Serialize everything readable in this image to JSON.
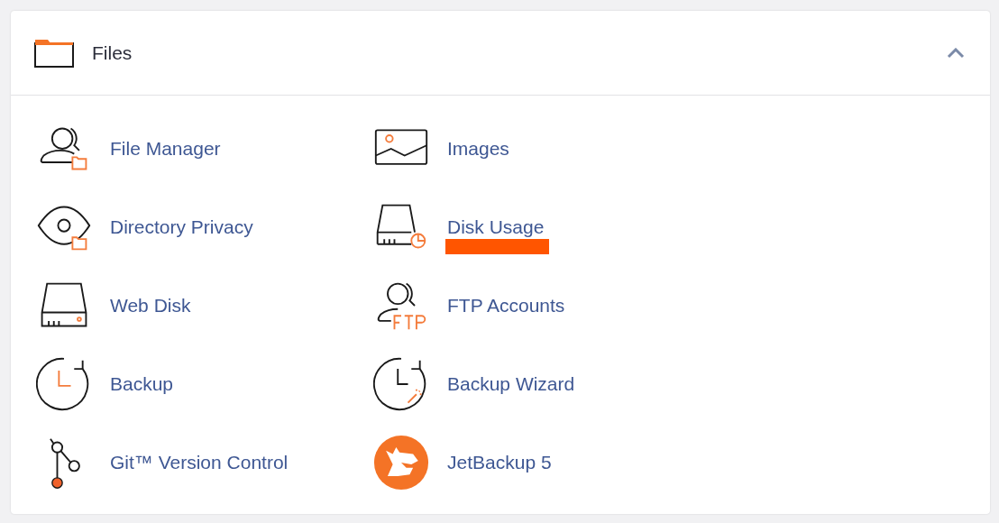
{
  "panel": {
    "title": "Files",
    "expanded": true
  },
  "items": [
    {
      "label": "File Manager",
      "kind": "file-manager",
      "highlighted": false
    },
    {
      "label": "Images",
      "kind": "images",
      "highlighted": false
    },
    {
      "label": "Directory Privacy",
      "kind": "directory-privacy",
      "highlighted": false
    },
    {
      "label": "Disk Usage",
      "kind": "disk-usage",
      "highlighted": true
    },
    {
      "label": "Web Disk",
      "kind": "web-disk",
      "highlighted": false
    },
    {
      "label": "FTP Accounts",
      "kind": "ftp-accounts",
      "highlighted": false
    },
    {
      "label": "Backup",
      "kind": "backup",
      "highlighted": false
    },
    {
      "label": "Backup Wizard",
      "kind": "backup-wizard",
      "highlighted": false
    },
    {
      "label": "Git™ Version Control",
      "kind": "git",
      "highlighted": false
    },
    {
      "label": "JetBackup 5",
      "kind": "jetbackup",
      "highlighted": false
    }
  ]
}
